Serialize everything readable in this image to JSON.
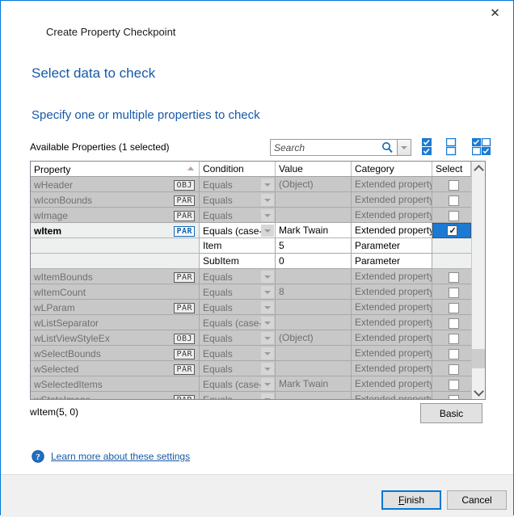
{
  "window": {
    "caption": "Create Property Checkpoint",
    "close_label": "✕"
  },
  "headings": {
    "main": "Select data to check",
    "sub": "Specify one or multiple properties to check"
  },
  "list_label": "Available Properties (1 selected)",
  "search": {
    "value": "",
    "placeholder": "Search",
    "icon": "search-icon",
    "dropdown_icon": "chevron-down-icon"
  },
  "selection_tools": [
    {
      "name": "select-all-icon",
      "tooltip": "Select All"
    },
    {
      "name": "deselect-all-icon",
      "tooltip": "Clear All"
    },
    {
      "name": "invert-selection-icon",
      "tooltip": "Invert Selection"
    }
  ],
  "grid": {
    "columns": [
      "Property",
      "Condition",
      "Value",
      "Category",
      "Select"
    ],
    "sort": {
      "column": "Property",
      "direction": "ascending"
    },
    "rows": [
      {
        "property": "wHeader",
        "badge": "OBJ",
        "condition": "Equals",
        "value": "(Object)",
        "category": "Extended property",
        "selected": false,
        "state": "disabled"
      },
      {
        "property": "wIconBounds",
        "badge": "PAR",
        "condition": "Equals",
        "value": "",
        "category": "Extended property",
        "selected": false,
        "state": "disabled"
      },
      {
        "property": "wImage",
        "badge": "PAR",
        "condition": "Equals",
        "value": "",
        "category": "Extended property",
        "selected": false,
        "state": "disabled"
      },
      {
        "property": "wItem",
        "badge": "PAR",
        "condition": "Equals (case-se",
        "value": "Mark Twain",
        "category": "Extended property",
        "selected": true,
        "state": "active"
      },
      {
        "property": "",
        "badge": "",
        "condition": "Item",
        "value": "5",
        "category": "Parameter",
        "selected": false,
        "state": "sub"
      },
      {
        "property": "",
        "badge": "",
        "condition": "SubItem",
        "value": "0",
        "category": "Parameter",
        "selected": false,
        "state": "sub"
      },
      {
        "property": "wItemBounds",
        "badge": "PAR",
        "condition": "Equals",
        "value": "",
        "category": "Extended property",
        "selected": false,
        "state": "disabled"
      },
      {
        "property": "wItemCount",
        "badge": "",
        "condition": "Equals",
        "value": "8",
        "category": "Extended property",
        "selected": false,
        "state": "disabled"
      },
      {
        "property": "wLParam",
        "badge": "PAR",
        "condition": "Equals",
        "value": "",
        "category": "Extended property",
        "selected": false,
        "state": "disabled"
      },
      {
        "property": "wListSeparator",
        "badge": "",
        "condition": "Equals (case-se",
        "value": "",
        "category": "Extended property",
        "selected": false,
        "state": "disabled"
      },
      {
        "property": "wListViewStyleEx",
        "badge": "OBJ",
        "condition": "Equals",
        "value": "(Object)",
        "category": "Extended property",
        "selected": false,
        "state": "disabled"
      },
      {
        "property": "wSelectBounds",
        "badge": "PAR",
        "condition": "Equals",
        "value": "",
        "category": "Extended property",
        "selected": false,
        "state": "disabled"
      },
      {
        "property": "wSelected",
        "badge": "PAR",
        "condition": "Equals",
        "value": "",
        "category": "Extended property",
        "selected": false,
        "state": "disabled"
      },
      {
        "property": "wSelectedItems",
        "badge": "",
        "condition": "Equals (case-se",
        "value": "Mark Twain",
        "category": "Extended property",
        "selected": false,
        "state": "disabled"
      },
      {
        "property": "wStateImage",
        "badge": "PAR",
        "condition": "Equals",
        "value": "",
        "category": "Extended property",
        "selected": false,
        "state": "disabled"
      }
    ]
  },
  "status_text": "wItem(5, 0)",
  "basic_button": "Basic",
  "help": {
    "icon": "help-icon",
    "link": "Learn more about these settings"
  },
  "footer": {
    "finish": {
      "mnemonic": "F",
      "rest": "inish"
    },
    "cancel": "Cancel"
  },
  "colors": {
    "accent": "#1659a8",
    "selection": "#1b7ad4",
    "focus": "#0078d7"
  }
}
